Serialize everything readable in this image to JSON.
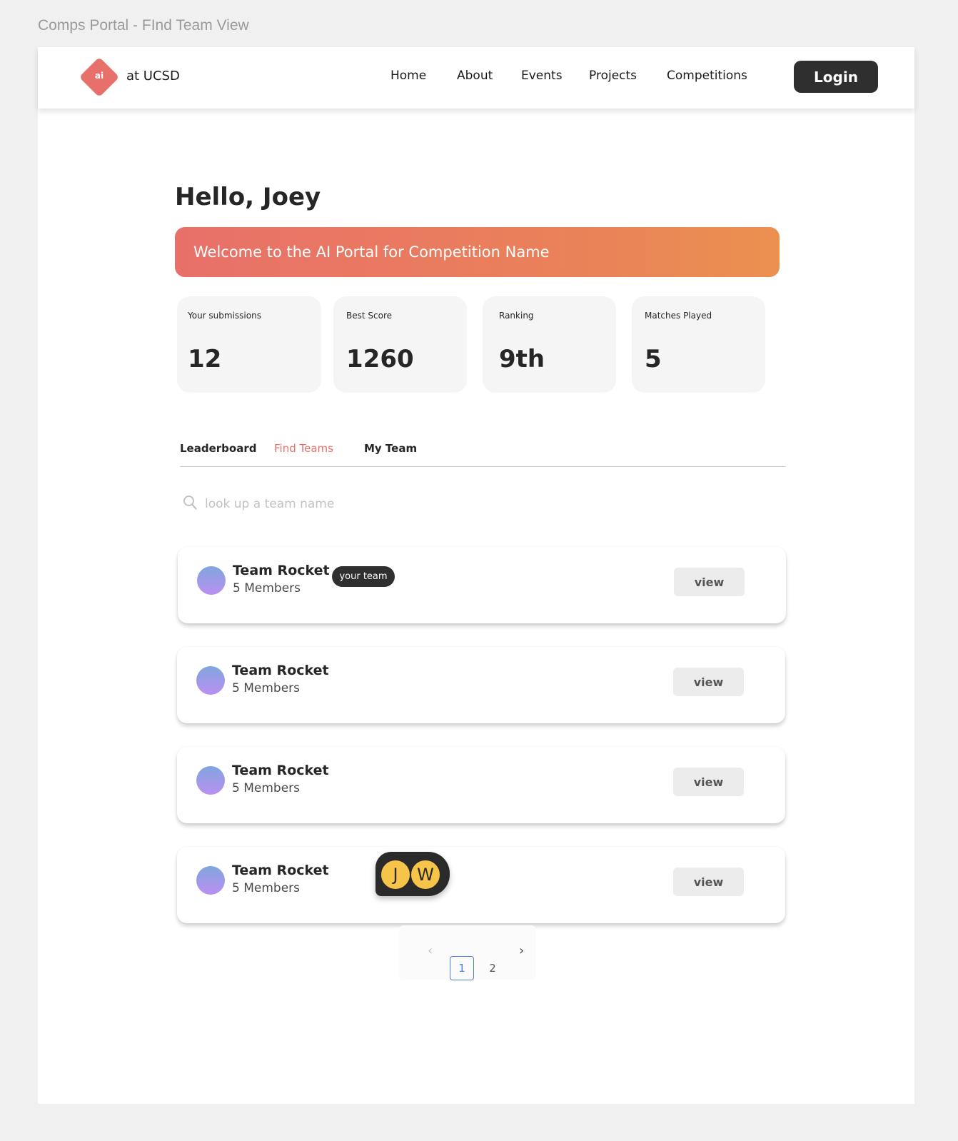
{
  "frame_title": "Comps Portal - FInd Team View",
  "nav": {
    "logo_text": "ai",
    "brand": "at UCSD",
    "items": [
      "Home",
      "About",
      "Events",
      "Projects",
      "Competitions"
    ],
    "login_label": "Login"
  },
  "greeting": "Hello, Joey",
  "banner_text": "Welcome to the AI Portal for Competition Name",
  "accent_color": "#e8706a",
  "stats": [
    {
      "label": "Your submissions",
      "value": "12"
    },
    {
      "label": "Best Score",
      "value": "1260"
    },
    {
      "label": "Ranking",
      "value": "9th"
    },
    {
      "label": "Matches Played",
      "value": "5"
    }
  ],
  "tabs": [
    {
      "label": "Leaderboard",
      "active": false
    },
    {
      "label": "Find Teams",
      "active": true
    },
    {
      "label": "My Team",
      "active": false
    }
  ],
  "search": {
    "placeholder": "look up a team name",
    "icon": "search-icon"
  },
  "teams": [
    {
      "name": "Team Rocket",
      "members": "5 Members",
      "badge": "your team",
      "view_label": "view"
    },
    {
      "name": "Team Rocket",
      "members": "5 Members",
      "view_label": "view"
    },
    {
      "name": "Team Rocket",
      "members": "5 Members",
      "view_label": "view"
    },
    {
      "name": "Team Rocket",
      "members": "5 Members",
      "view_label": "view"
    }
  ],
  "pagination": {
    "pages": [
      "1",
      "2"
    ],
    "current": "1",
    "prev": "‹",
    "next": "›"
  },
  "presence": {
    "users": [
      "J",
      "W"
    ]
  }
}
